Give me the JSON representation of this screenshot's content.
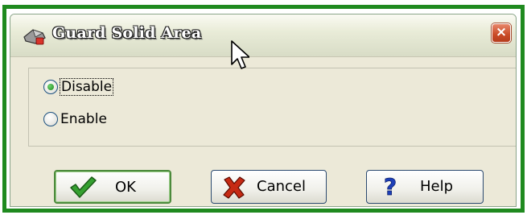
{
  "dialog": {
    "title": "Guard Solid Area",
    "close_label": "×",
    "window_icon": "guard-app-icon"
  },
  "options": [
    {
      "label": "Disable",
      "selected": true,
      "focused": true
    },
    {
      "label": "Enable",
      "selected": false,
      "focused": false
    }
  ],
  "buttons": {
    "ok_label": "OK",
    "cancel_label": "Cancel",
    "help_label": "Help"
  },
  "colors": {
    "frame_border": "#1f8a1f",
    "dialog_bg": "#ece9d8",
    "close_button": "#c94a26",
    "check_icon": "#2a8a2a",
    "cancel_icon": "#c02010",
    "help_icon": "#1d3fb8"
  }
}
